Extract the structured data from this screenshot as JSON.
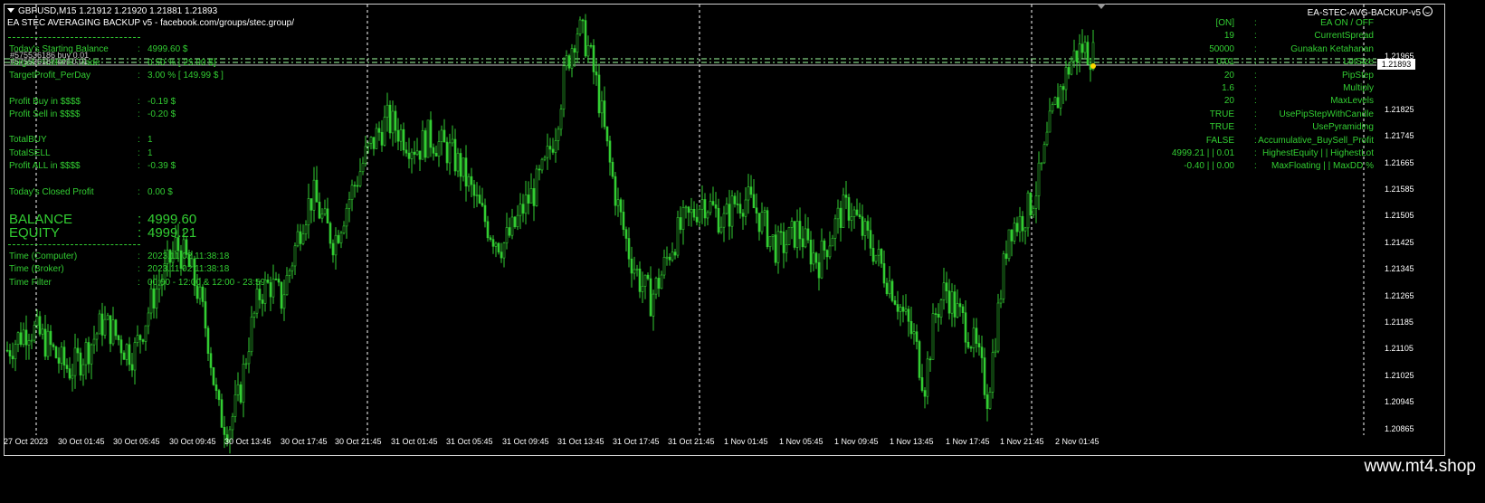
{
  "header": {
    "symbol_line": "GBPUSD,M15  1.21912 1.21920 1.21881 1.21893",
    "ea_title": "EA STEC AVERAGING BACKUP v5 - facebook.com/groups/stec.group/",
    "ea_name": "EA-STEC-AVG-BACKUP-v5"
  },
  "left_panel": {
    "rows": [
      {
        "label": "Today's Starting Balance",
        "value": "4999.60 $"
      },
      {
        "label": "Target Profit Per Trade",
        "value": "0.50 % [ 25.00 $]"
      },
      {
        "label": "TargetProfit_PerDay",
        "value": "3.00 % [ 149.99 $ ]"
      },
      {
        "label": "Profit Buy in $$$$",
        "value": "-0.19 $"
      },
      {
        "label": "Profit Sell in $$$$",
        "value": "-0.20 $"
      },
      {
        "label": "TotalBUY",
        "value": "1"
      },
      {
        "label": "TotalSELL",
        "value": "1"
      },
      {
        "label": "Profit ALL in $$$$",
        "value": "-0.39 $"
      },
      {
        "label": "Today's Closed Profit",
        "value": "0.00 $"
      }
    ],
    "balance_label": "BALANCE",
    "balance_value": "4999.60",
    "equity_label": "EQUITY",
    "equity_value": "4999.21",
    "time_rows": [
      {
        "label": "Time (Computer)",
        "value": "2023.11.02 11:38:18"
      },
      {
        "label": "Time (Broker)",
        "value": "2023.11.02 11:38:18"
      },
      {
        "label": "Time Filter",
        "value": "00:00 - 12:00 & 12:00 - 23:59"
      }
    ],
    "tickets": [
      "#575536186 buy 0.01",
      "#575536187 sell 0.01"
    ]
  },
  "right_panel": {
    "rows": [
      {
        "value": "[ON]",
        "label": "EA ON / OFF"
      },
      {
        "value": "19",
        "label": "CurrentSpread"
      },
      {
        "value": "50000",
        "label": "Gunakan Ketahanan"
      },
      {
        "value": "0.01",
        "label": "LotSize"
      },
      {
        "value": "20",
        "label": "PipStep"
      },
      {
        "value": "1.6",
        "label": "Multiply"
      },
      {
        "value": "20",
        "label": "MaxLevels"
      },
      {
        "value": "TRUE",
        "label": "UsePipStepWithCandle"
      },
      {
        "value": "TRUE",
        "label": "UsePyramiding"
      },
      {
        "value": "FALSE",
        "label": "Accumulative_BuySell_Profit"
      },
      {
        "value": "4999.21 | | 0.01",
        "label": "HighestEquity | | HighestLot"
      },
      {
        "value": "-0.40 | | 0.00",
        "label": "MaxFloating | |  MaxDD %"
      }
    ]
  },
  "y_axis": {
    "ticks": [
      "1.21965",
      "1.21893",
      "1.21825",
      "1.21745",
      "1.21665",
      "1.21585",
      "1.21505",
      "1.21425",
      "1.21345",
      "1.21265",
      "1.21185",
      "1.21105",
      "1.21025",
      "1.20945",
      "1.20865"
    ],
    "current_price": "1.21893"
  },
  "x_axis": {
    "ticks": [
      "27 Oct 2023",
      "30 Oct 01:45",
      "30 Oct 05:45",
      "30 Oct 09:45",
      "30 Oct 13:45",
      "30 Oct 17:45",
      "30 Oct 21:45",
      "31 Oct 01:45",
      "31 Oct 05:45",
      "31 Oct 09:45",
      "31 Oct 13:45",
      "31 Oct 17:45",
      "31 Oct 21:45",
      "1 Nov 01:45",
      "1 Nov 05:45",
      "1 Nov 09:45",
      "1 Nov 13:45",
      "1 Nov 17:45",
      "1 Nov 21:45",
      "2 Nov 01:45"
    ]
  },
  "chart_data": {
    "type": "candlestick",
    "color": "#32cd32",
    "ylim": [
      1.2086,
      1.2202
    ],
    "close_series": [
      1.2113,
      1.2116,
      1.2119,
      1.2117,
      1.2114,
      1.211,
      1.2108,
      1.2111,
      1.2115,
      1.212,
      1.2118,
      1.2114,
      1.2112,
      1.212,
      1.2128,
      1.2133,
      1.214,
      1.2136,
      1.2129,
      1.2117,
      1.2097,
      1.2093,
      1.2101,
      1.2117,
      1.2128,
      1.213,
      1.2126,
      1.2136,
      1.2147,
      1.2153,
      1.2146,
      1.2141,
      1.2149,
      1.2156,
      1.2163,
      1.2168,
      1.2172,
      1.217,
      1.2167,
      1.2165,
      1.2168,
      1.2166,
      1.2164,
      1.216,
      1.2154,
      1.2148,
      1.2143,
      1.214,
      1.2144,
      1.215,
      1.2154,
      1.216,
      1.217,
      1.2186,
      1.2196,
      1.2192,
      1.218,
      1.2163,
      1.2149,
      1.2138,
      1.2131,
      1.2126,
      1.2132,
      1.214,
      1.2145,
      1.2148,
      1.2152,
      1.2149,
      1.2146,
      1.2151,
      1.2152,
      1.2149,
      1.2144,
      1.2139,
      1.2141,
      1.2144,
      1.2139,
      1.2136,
      1.2142,
      1.2148,
      1.215,
      1.2144,
      1.214,
      1.2134,
      1.2129,
      1.2122,
      1.2116,
      1.2104,
      1.2122,
      1.2129,
      1.2123,
      1.2119,
      1.2112,
      1.2101,
      1.2123,
      1.2145,
      1.2146,
      1.215,
      1.2158,
      1.2172,
      1.2181,
      1.2188,
      1.2191,
      1.2189
    ]
  }
}
